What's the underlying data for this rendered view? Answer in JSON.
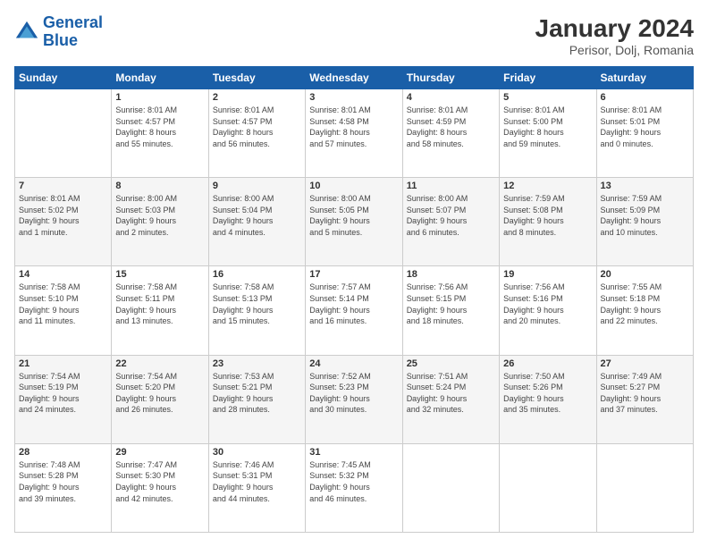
{
  "logo": {
    "line1": "General",
    "line2": "Blue"
  },
  "title": "January 2024",
  "subtitle": "Perisor, Dolj, Romania",
  "days_of_week": [
    "Sunday",
    "Monday",
    "Tuesday",
    "Wednesday",
    "Thursday",
    "Friday",
    "Saturday"
  ],
  "weeks": [
    [
      {
        "day": "",
        "info": ""
      },
      {
        "day": "1",
        "info": "Sunrise: 8:01 AM\nSunset: 4:57 PM\nDaylight: 8 hours\nand 55 minutes."
      },
      {
        "day": "2",
        "info": "Sunrise: 8:01 AM\nSunset: 4:57 PM\nDaylight: 8 hours\nand 56 minutes."
      },
      {
        "day": "3",
        "info": "Sunrise: 8:01 AM\nSunset: 4:58 PM\nDaylight: 8 hours\nand 57 minutes."
      },
      {
        "day": "4",
        "info": "Sunrise: 8:01 AM\nSunset: 4:59 PM\nDaylight: 8 hours\nand 58 minutes."
      },
      {
        "day": "5",
        "info": "Sunrise: 8:01 AM\nSunset: 5:00 PM\nDaylight: 8 hours\nand 59 minutes."
      },
      {
        "day": "6",
        "info": "Sunrise: 8:01 AM\nSunset: 5:01 PM\nDaylight: 9 hours\nand 0 minutes."
      }
    ],
    [
      {
        "day": "7",
        "info": "Sunrise: 8:01 AM\nSunset: 5:02 PM\nDaylight: 9 hours\nand 1 minute."
      },
      {
        "day": "8",
        "info": "Sunrise: 8:00 AM\nSunset: 5:03 PM\nDaylight: 9 hours\nand 2 minutes."
      },
      {
        "day": "9",
        "info": "Sunrise: 8:00 AM\nSunset: 5:04 PM\nDaylight: 9 hours\nand 4 minutes."
      },
      {
        "day": "10",
        "info": "Sunrise: 8:00 AM\nSunset: 5:05 PM\nDaylight: 9 hours\nand 5 minutes."
      },
      {
        "day": "11",
        "info": "Sunrise: 8:00 AM\nSunset: 5:07 PM\nDaylight: 9 hours\nand 6 minutes."
      },
      {
        "day": "12",
        "info": "Sunrise: 7:59 AM\nSunset: 5:08 PM\nDaylight: 9 hours\nand 8 minutes."
      },
      {
        "day": "13",
        "info": "Sunrise: 7:59 AM\nSunset: 5:09 PM\nDaylight: 9 hours\nand 10 minutes."
      }
    ],
    [
      {
        "day": "14",
        "info": "Sunrise: 7:58 AM\nSunset: 5:10 PM\nDaylight: 9 hours\nand 11 minutes."
      },
      {
        "day": "15",
        "info": "Sunrise: 7:58 AM\nSunset: 5:11 PM\nDaylight: 9 hours\nand 13 minutes."
      },
      {
        "day": "16",
        "info": "Sunrise: 7:58 AM\nSunset: 5:13 PM\nDaylight: 9 hours\nand 15 minutes."
      },
      {
        "day": "17",
        "info": "Sunrise: 7:57 AM\nSunset: 5:14 PM\nDaylight: 9 hours\nand 16 minutes."
      },
      {
        "day": "18",
        "info": "Sunrise: 7:56 AM\nSunset: 5:15 PM\nDaylight: 9 hours\nand 18 minutes."
      },
      {
        "day": "19",
        "info": "Sunrise: 7:56 AM\nSunset: 5:16 PM\nDaylight: 9 hours\nand 20 minutes."
      },
      {
        "day": "20",
        "info": "Sunrise: 7:55 AM\nSunset: 5:18 PM\nDaylight: 9 hours\nand 22 minutes."
      }
    ],
    [
      {
        "day": "21",
        "info": "Sunrise: 7:54 AM\nSunset: 5:19 PM\nDaylight: 9 hours\nand 24 minutes."
      },
      {
        "day": "22",
        "info": "Sunrise: 7:54 AM\nSunset: 5:20 PM\nDaylight: 9 hours\nand 26 minutes."
      },
      {
        "day": "23",
        "info": "Sunrise: 7:53 AM\nSunset: 5:21 PM\nDaylight: 9 hours\nand 28 minutes."
      },
      {
        "day": "24",
        "info": "Sunrise: 7:52 AM\nSunset: 5:23 PM\nDaylight: 9 hours\nand 30 minutes."
      },
      {
        "day": "25",
        "info": "Sunrise: 7:51 AM\nSunset: 5:24 PM\nDaylight: 9 hours\nand 32 minutes."
      },
      {
        "day": "26",
        "info": "Sunrise: 7:50 AM\nSunset: 5:26 PM\nDaylight: 9 hours\nand 35 minutes."
      },
      {
        "day": "27",
        "info": "Sunrise: 7:49 AM\nSunset: 5:27 PM\nDaylight: 9 hours\nand 37 minutes."
      }
    ],
    [
      {
        "day": "28",
        "info": "Sunrise: 7:48 AM\nSunset: 5:28 PM\nDaylight: 9 hours\nand 39 minutes."
      },
      {
        "day": "29",
        "info": "Sunrise: 7:47 AM\nSunset: 5:30 PM\nDaylight: 9 hours\nand 42 minutes."
      },
      {
        "day": "30",
        "info": "Sunrise: 7:46 AM\nSunset: 5:31 PM\nDaylight: 9 hours\nand 44 minutes."
      },
      {
        "day": "31",
        "info": "Sunrise: 7:45 AM\nSunset: 5:32 PM\nDaylight: 9 hours\nand 46 minutes."
      },
      {
        "day": "",
        "info": ""
      },
      {
        "day": "",
        "info": ""
      },
      {
        "day": "",
        "info": ""
      }
    ]
  ]
}
